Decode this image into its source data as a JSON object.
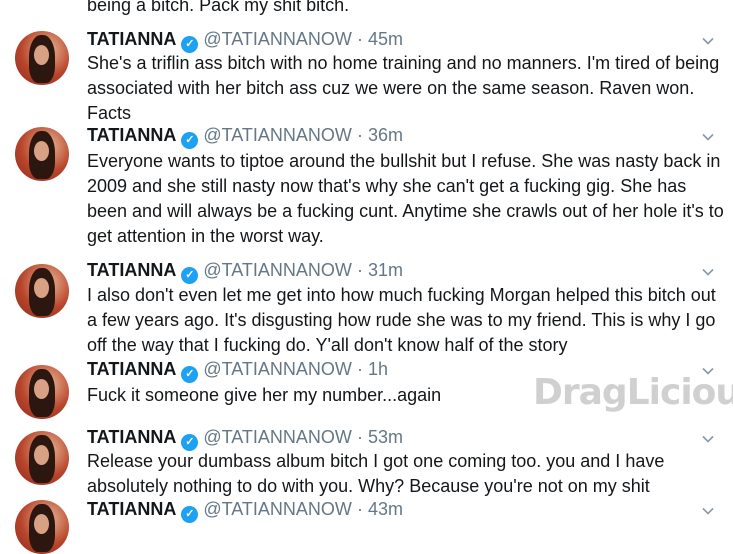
{
  "top_text": "being a bitch. Pack my shit bitch.",
  "tweets": [
    {
      "name": "TATIANNA",
      "handle": "@TATIANNANOW",
      "time": "45m",
      "text": "She's a triflin ass bitch with no home training and no manners. I'm tired of being associated with her bitch ass cuz we were on the same season. Raven won. Facts"
    },
    {
      "name": "TATIANNA",
      "handle": "@TATIANNANOW",
      "time": "36m",
      "text": "Everyone wants to tiptoe around the bullshit but I refuse. She was nasty back in 2009 and she still nasty now that's why she can't get a fucking gig. She has been and will always be a fucking cunt.  Anytime she crawls out of her hole it's to get attention in the worst way."
    },
    {
      "name": "TATIANNA",
      "handle": "@TATIANNANOW",
      "time": "31m",
      "text": "I also don't even let me get into how much fucking Morgan helped this bitch out a few years ago. It's disgusting how rude she was to my friend. This is why I go off the way that I fucking do. Y'all don't know half of the story"
    },
    {
      "name": "TATIANNA",
      "handle": "@TATIANNANOW",
      "time": "1h",
      "text": "Fuck it someone give her my number...again"
    },
    {
      "name": "TATIANNA",
      "handle": "@TATIANNANOW",
      "time": "53m",
      "text": "Release your dumbass album bitch I got one coming too. you and I have absolutely nothing to do with you. Why? Because you're not on my shit"
    },
    {
      "name": "TATIANNA",
      "handle": "@TATIANNANOW",
      "time": "43m",
      "text": ""
    }
  ],
  "watermark": "DragLicious",
  "colors": {
    "verified": "#1da1f2",
    "meta": "#657786",
    "text": "#14171a"
  },
  "icons": {
    "verified": "verified-badge-icon",
    "caret": "chevron-down-icon"
  }
}
